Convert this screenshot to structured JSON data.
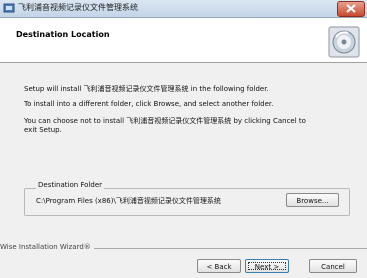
{
  "window": {
    "title": "飞利浦音视频记录仪文件管理系统"
  },
  "header": {
    "title": "Destination Location",
    "logo_icon": "installer-cd-icon"
  },
  "body": {
    "line1": "Setup will install 飞利浦音视频记录仪文件管理系统 in the following folder.",
    "line2": "To install into a different folder, click Browse, and select another folder.",
    "line3": "You can choose not to install 飞利浦音视频记录仪文件管理系统 by clicking Cancel to",
    "line3b": "exit Setup."
  },
  "destination": {
    "legend": "Destination Folder",
    "path": "C:\\Program Files (x86)\\飞利浦音视频记录仪文件管理系统",
    "browse_label": "Browse..."
  },
  "footer": {
    "label": "Wise Installation Wizard®",
    "back_label": "< Back",
    "next_label": "Next >",
    "cancel_label": "Cancel"
  }
}
